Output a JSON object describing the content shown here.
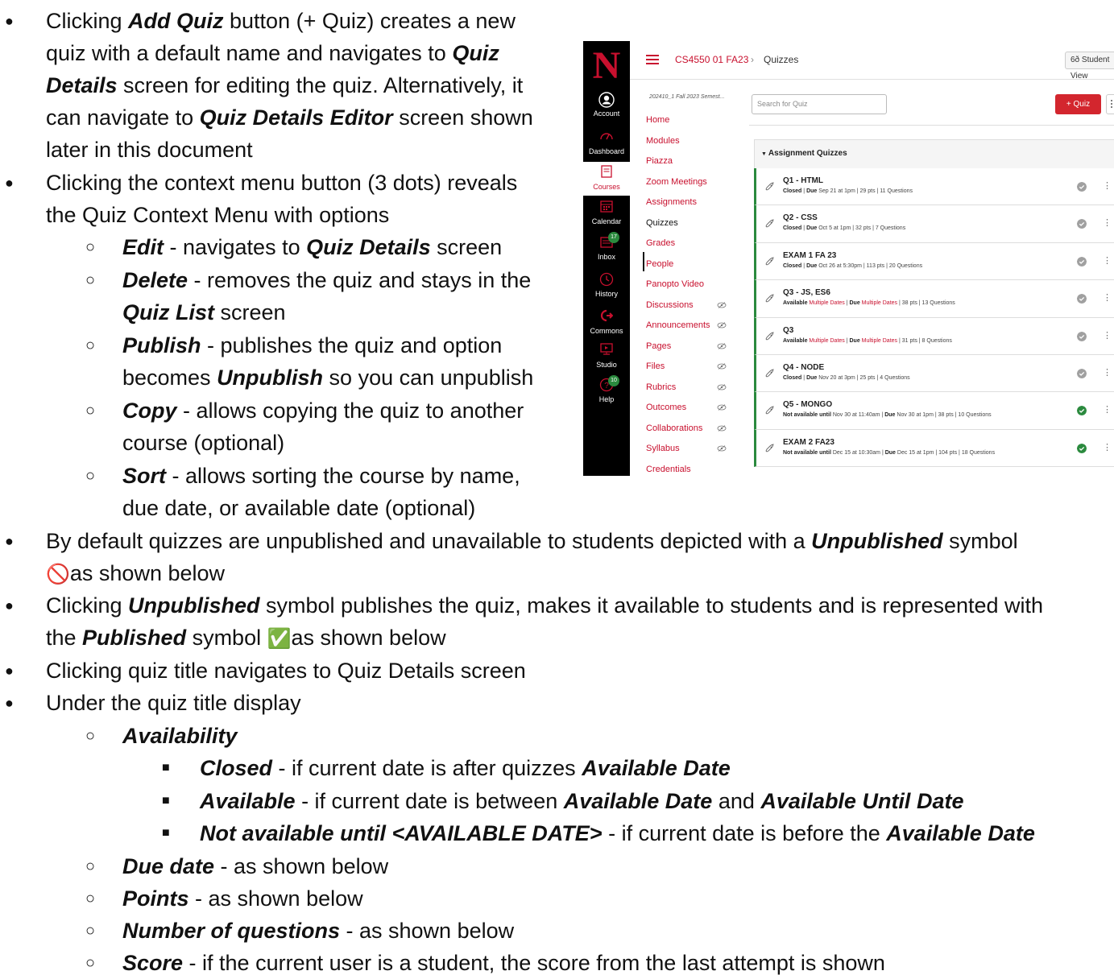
{
  "doc": {
    "bullet": "●",
    "sub_bullet": "○",
    "sub_sub_bullet": "■",
    "l1_add_quiz": {
      "t1": "Clicking ",
      "b1": "Add Quiz",
      "t2": " button (+ Quiz) creates a new",
      "line2_t1": "quiz with a default name and navigates to ",
      "line2_b1": "Quiz",
      "line3_b1": "Details",
      "line3_t1": " screen for editing the quiz. Alternatively, it",
      "line4_t1": "can navigate to ",
      "line4_b1": "Quiz Details Editor",
      "line4_t2": " screen shown",
      "line5_t1": "later in this document"
    },
    "l1_context": {
      "line1": "Clicking the context menu button (3 dots) reveals",
      "line2": "the Quiz Context Menu with options"
    },
    "context_items": [
      {
        "b": "Edit",
        "t": " - navigates to ",
        "b2": "Quiz Details",
        "t2": " screen"
      },
      {
        "b": "Delete",
        "t": " - removes the quiz and stays in the"
      },
      {
        "b": "Quiz List",
        "t": " screen"
      },
      {
        "b": "Publish",
        "t": " - publishes the quiz and option"
      },
      {
        "t": "becomes ",
        "b": "Unpublish",
        "t2": " so you can unpublish"
      },
      {
        "b": "Copy",
        "t": " - allows copying the quiz to another"
      },
      {
        "t": "course (optional)"
      },
      {
        "b": "Sort",
        "t": " - allows sorting the course by name,"
      },
      {
        "t": "due date, or available date (optional)"
      }
    ],
    "l1_default": {
      "t1": "By default quizzes are unpublished and unavailable to students depicted with a ",
      "b1": "Unpublished",
      "t2": " symbol",
      "emoji": "🚫",
      "t3": "as shown below"
    },
    "l1_click_unpub": {
      "t1": "Clicking ",
      "b1": "Unpublished",
      "t2": " symbol publishes the quiz, makes it available to students and is represented with",
      "line2_t1": "the ",
      "line2_b1": "Published",
      "line2_t2": " symbol ",
      "emoji": "✅",
      "line2_t3": "as shown below"
    },
    "l1_title": "Clicking quiz title navigates to Quiz Details screen",
    "l1_under": "Under the quiz title display",
    "availability": "Availability",
    "avail_items": [
      {
        "b": "Closed",
        "t": " - if current date is after quizzes ",
        "b2": "Available Date"
      },
      {
        "b": "Available",
        "t": " - if current date is between ",
        "b2": "Available Date",
        "t2": " and ",
        "b3": "Available Until Date"
      },
      {
        "b": "Not available until <AVAILABLE DATE>",
        "t": " - if current date is before the ",
        "b2": "Available Date"
      }
    ],
    "under_items": [
      {
        "b": "Due date",
        "t": " - as shown below"
      },
      {
        "b": "Points",
        "t": " - as shown below"
      },
      {
        "b": "Number of questions",
        "t": " - as shown below"
      },
      {
        "b": "Score",
        "t": " - if the current user is a student, the score from the last attempt is shown"
      }
    ]
  },
  "screenshot": {
    "global_nav": [
      {
        "label": "Account",
        "icon": "account-icon"
      },
      {
        "label": "Dashboard",
        "icon": "dashboard-icon"
      },
      {
        "label": "Courses",
        "icon": "courses-icon"
      },
      {
        "label": "Calendar",
        "icon": "calendar-icon"
      },
      {
        "label": "Inbox",
        "icon": "inbox-icon",
        "badge": "17"
      },
      {
        "label": "History",
        "icon": "history-icon"
      },
      {
        "label": "Commons",
        "icon": "commons-icon"
      },
      {
        "label": "Studio",
        "icon": "studio-icon",
        "badge": "10"
      },
      {
        "label": "Help",
        "icon": "help-icon"
      }
    ],
    "breadcrumb": {
      "course": "CS4550 01 FA23",
      "sep": "›",
      "page": "Quizzes"
    },
    "student_view": "Student View",
    "term": "202410_1 Fall 2023 Semest...",
    "course_nav": [
      "Home",
      "Modules",
      "Piazza",
      "Zoom Meetings",
      "Assignments",
      "Quizzes",
      "Grades",
      "People",
      "Panopto Video",
      "Discussions",
      "Announcements",
      "Pages",
      "Files",
      "Rubrics",
      "Outcomes",
      "Collaborations",
      "Syllabus",
      "Credentials"
    ],
    "course_nav_hidden": [
      9,
      10,
      11,
      12,
      13,
      14,
      15,
      16
    ],
    "search_placeholder": "Search for Quiz",
    "add_quiz": "+ Quiz",
    "group_title": "Assignment Quizzes",
    "quizzes": [
      {
        "title": "Q1 - HTML",
        "status": "Closed",
        "due_label": "Due",
        "due": "Sep 21 at 1pm",
        "pts": "29 pts",
        "qs": "11 Questions",
        "published": false
      },
      {
        "title": "Q2 - CSS",
        "status": "Closed",
        "due_label": "Due",
        "due": "Oct 5 at 1pm",
        "pts": "32 pts",
        "qs": "7 Questions",
        "published": false
      },
      {
        "title": "EXAM 1 FA 23",
        "status": "Closed",
        "due_label": "Due",
        "due": "Oct 26 at 5:30pm",
        "pts": "113 pts",
        "qs": "20 Questions",
        "published": false
      },
      {
        "title": "Q3 - JS, ES6",
        "status": "Available",
        "status_extra": "Multiple Dates",
        "due_label": "Due",
        "due": "Multiple Dates",
        "pts": "38 pts",
        "qs": "13 Questions",
        "published": false
      },
      {
        "title": "Q3",
        "status": "Available",
        "status_extra": "Multiple Dates",
        "due_label": "Due",
        "due": "Multiple Dates",
        "pts": "31 pts",
        "qs": "8 Questions",
        "published": false
      },
      {
        "title": "Q4 - NODE",
        "status": "Closed",
        "due_label": "Due",
        "due": "Nov 20 at 3pm",
        "pts": "25 pts",
        "qs": "4 Questions",
        "published": false
      },
      {
        "title": "Q5 - MONGO",
        "status": "Not available until",
        "status_extra": "Nov 30 at 11:40am",
        "due_label": "Due",
        "due": "Nov 30 at 1pm",
        "pts": "38 pts",
        "qs": "10 Questions",
        "published": true
      },
      {
        "title": "EXAM 2 FA23",
        "status": "Not available until",
        "status_extra": "Dec 15 at 10:30am",
        "due_label": "Due",
        "due": "Dec 15 at 1pm",
        "pts": "104 pts",
        "qs": "18 Questions",
        "published": true
      }
    ],
    "colors": {
      "brand_red": "#c8102e",
      "published_green": "#2b8a3e",
      "unpublished_gray": "#a0a0a0"
    }
  }
}
